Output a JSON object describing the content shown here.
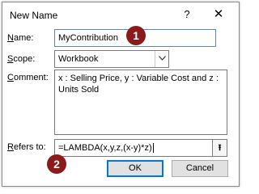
{
  "dialog": {
    "title": "New Name",
    "help_label": "?",
    "close_label": "✕"
  },
  "form": {
    "name_label_first": "N",
    "name_label_rest": "ame:",
    "name_value": "MyContribution",
    "scope_label_first": "S",
    "scope_label_rest": "cope:",
    "scope_value": "Workbook",
    "comment_label_first": "C",
    "comment_label_rest": "omment:",
    "comment_value": "x : Selling Price, y : Variable Cost and z : Units Sold",
    "refers_label_first": "R",
    "refers_label_rest": "efers to:",
    "refers_value": "=LAMBDA(x,y,z,(x-y)*z)",
    "collapse_label": "⭱"
  },
  "buttons": {
    "ok_label": "OK",
    "cancel_label": "Cancel"
  },
  "annotations": {
    "badge_1": "1",
    "badge_2": "2",
    "badge_color": "#8b1a1a"
  },
  "icons": {
    "scope_dropdown": "chevron-down-icon",
    "refers_collapse": "collapse-dialog-icon"
  }
}
